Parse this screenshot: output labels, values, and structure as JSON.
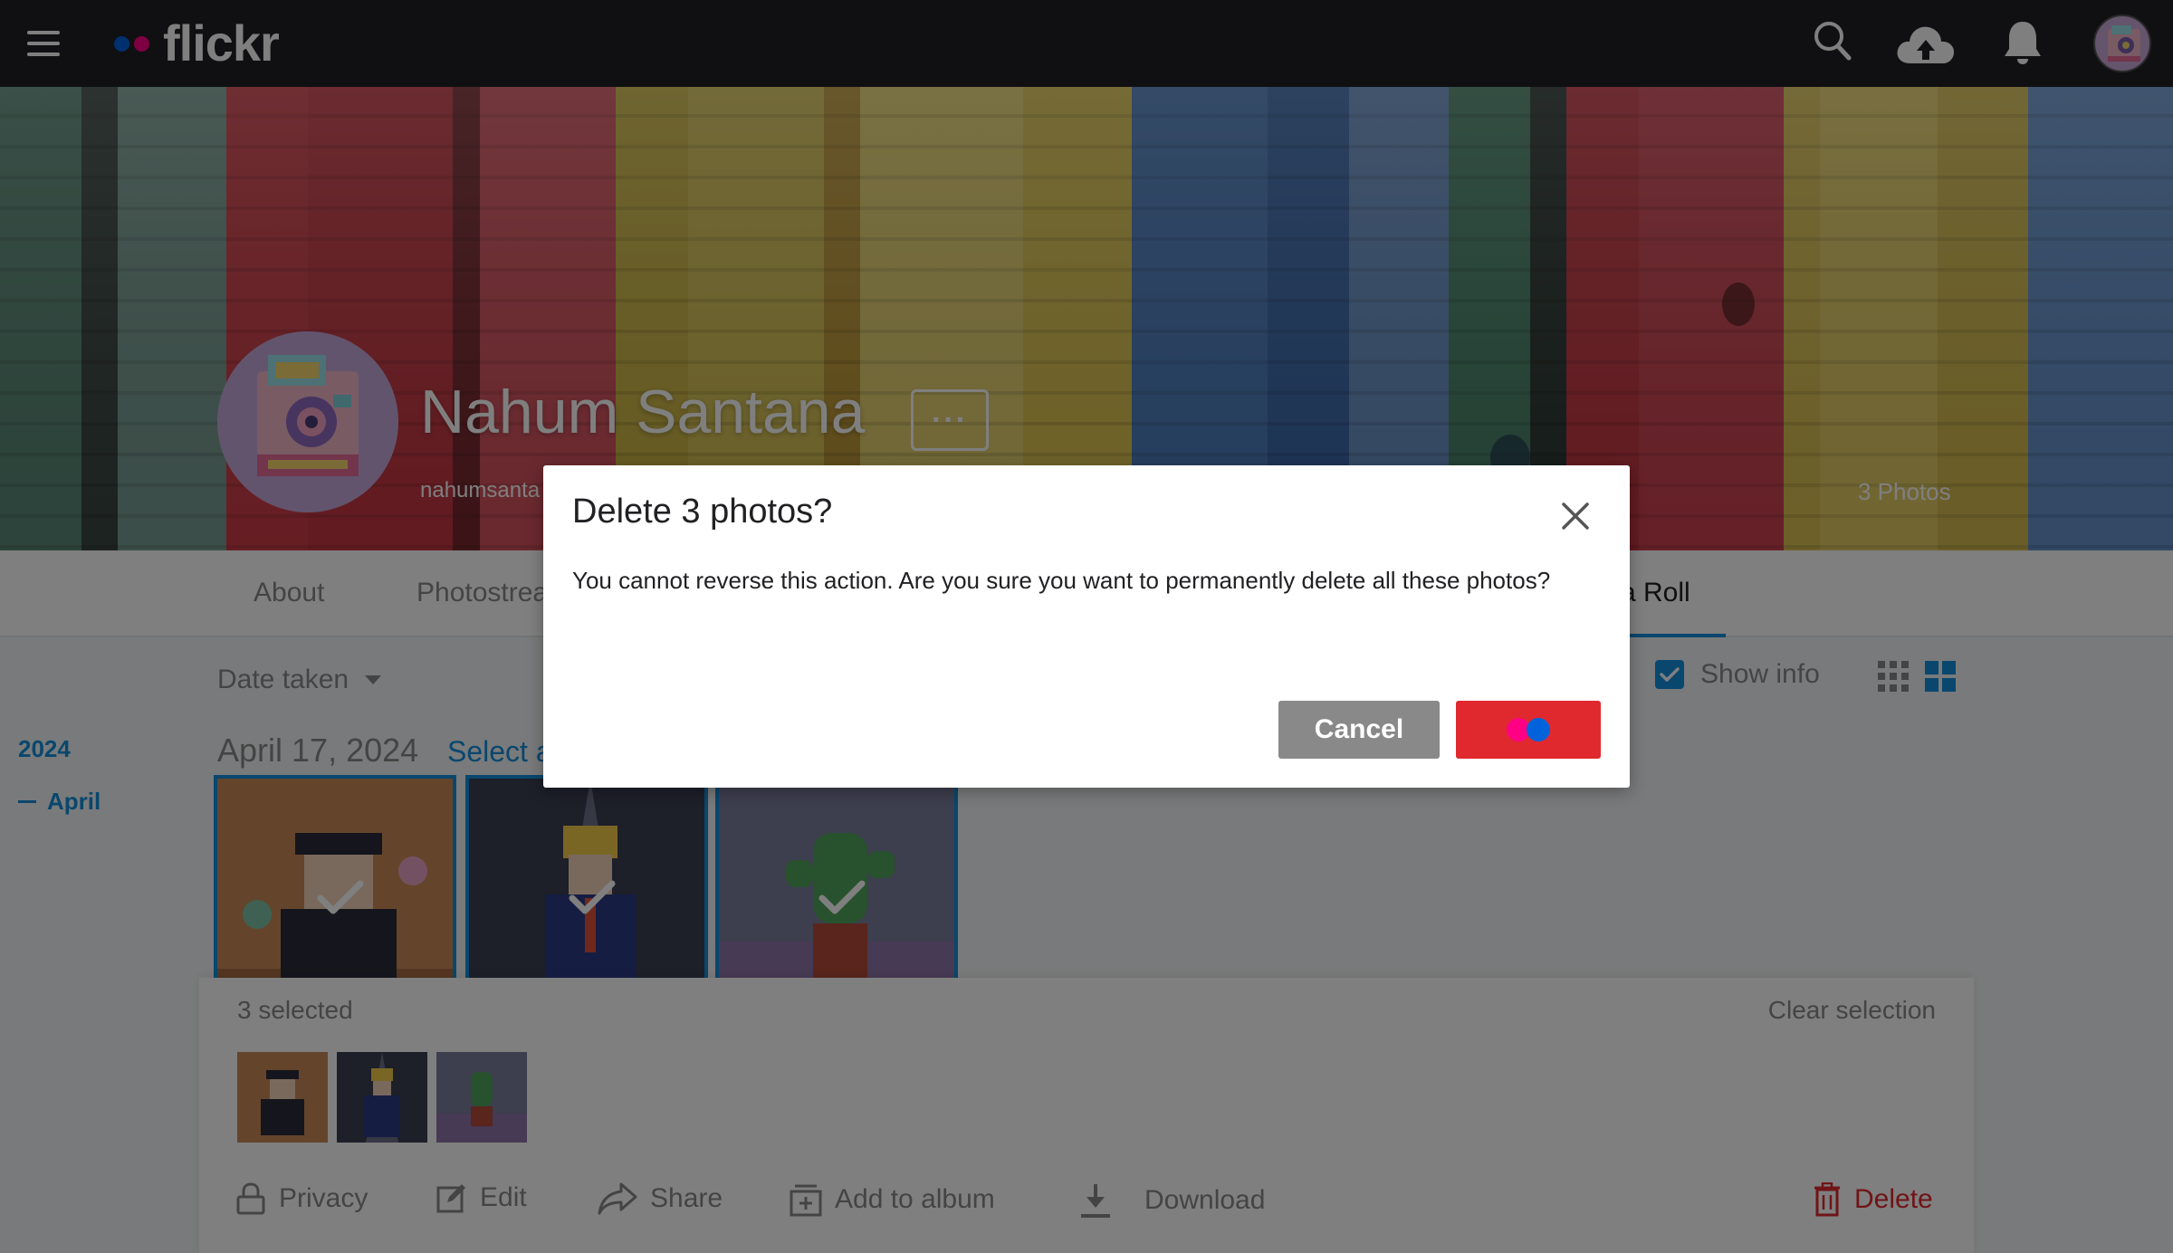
{
  "app": {
    "logo_text": "flickr",
    "brand_colors": {
      "pink": "#ff0084",
      "blue": "#0063dc"
    }
  },
  "topnav": {
    "icons": [
      "menu-icon",
      "search-icon",
      "upload-cloud-icon",
      "notifications-bell-icon",
      "user-avatar"
    ]
  },
  "profile": {
    "name": "Nahum Santana",
    "username": "nahumsanta",
    "more_label": "···",
    "photo_count": "3 Photos"
  },
  "subnav": {
    "tabs": [
      {
        "label": "About"
      },
      {
        "label": "Photostrea"
      },
      {
        "label": "a Roll"
      }
    ],
    "active_tab": "a Roll"
  },
  "toolbar": {
    "sort_label": "Date taken",
    "show_info_label": "Show info",
    "show_info_checked": true,
    "view_modes": [
      "small-grid-icon",
      "large-grid-icon"
    ]
  },
  "timeline": {
    "year": "2024",
    "month": "April"
  },
  "group": {
    "date": "April 17, 2024",
    "select_all_label": "Select a"
  },
  "photos": [
    {
      "name": "photo-hanako-kun",
      "selected": true
    },
    {
      "name": "photo-blond-suit",
      "selected": true
    },
    {
      "name": "photo-cactus-pot",
      "selected": true
    }
  ],
  "selection": {
    "count_label": "3 selected",
    "clear_label": "Clear selection",
    "actions": {
      "privacy": "Privacy",
      "edit": "Edit",
      "share": "Share",
      "add_to_album": "Add to album",
      "download": "Download",
      "delete": "Delete"
    }
  },
  "dialog": {
    "title": "Delete 3 photos?",
    "body": "You cannot reverse this action. Are you sure you want to permanently delete all these photos?",
    "cancel_label": "Cancel",
    "confirm_state": "loading"
  },
  "colors": {
    "accent_blue": "#128fdc",
    "danger_red": "#e0292e",
    "nav_bg": "#212124",
    "muted_gray": "#898989"
  }
}
